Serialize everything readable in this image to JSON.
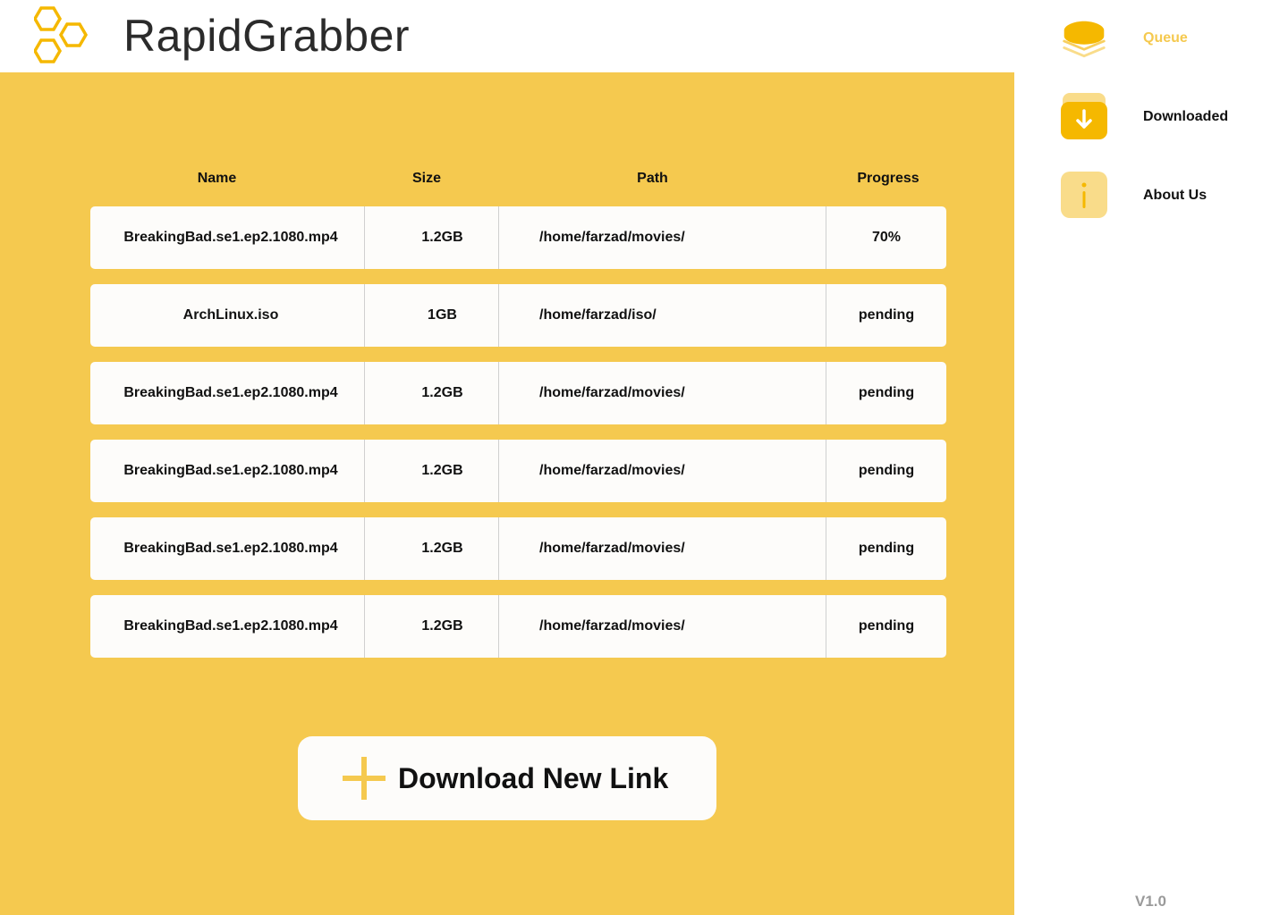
{
  "app": {
    "title": "RapidGrabber",
    "version": "V1.0"
  },
  "colors": {
    "accent": "#f5c94f",
    "accent_dark": "#f5b800",
    "row_background": "#fdfcfa",
    "text": "#111111",
    "muted": "#9a9a9a"
  },
  "sidebar": {
    "items": [
      {
        "label": "Queue",
        "icon": "stack-icon",
        "active": true
      },
      {
        "label": "Downloaded",
        "icon": "download-arrow-icon",
        "active": false
      },
      {
        "label": "About Us",
        "icon": "info-icon",
        "active": false
      }
    ]
  },
  "table": {
    "columns": [
      "Name",
      "Size",
      "Path",
      "Progress"
    ],
    "rows": [
      {
        "name": "BreakingBad.se1.ep2.1080.mp4",
        "size": "1.2GB",
        "path": "/home/farzad/movies/",
        "progress": "70%"
      },
      {
        "name": "ArchLinux.iso",
        "size": "1GB",
        "path": "/home/farzad/iso/",
        "progress": "pending"
      },
      {
        "name": "BreakingBad.se1.ep2.1080.mp4",
        "size": "1.2GB",
        "path": "/home/farzad/movies/",
        "progress": "pending"
      },
      {
        "name": "BreakingBad.se1.ep2.1080.mp4",
        "size": "1.2GB",
        "path": "/home/farzad/movies/",
        "progress": "pending"
      },
      {
        "name": "BreakingBad.se1.ep2.1080.mp4",
        "size": "1.2GB",
        "path": "/home/farzad/movies/",
        "progress": "pending"
      },
      {
        "name": "BreakingBad.se1.ep2.1080.mp4",
        "size": "1.2GB",
        "path": "/home/farzad/movies/",
        "progress": "pending"
      }
    ]
  },
  "actions": {
    "download_new_link": "Download New Link"
  }
}
